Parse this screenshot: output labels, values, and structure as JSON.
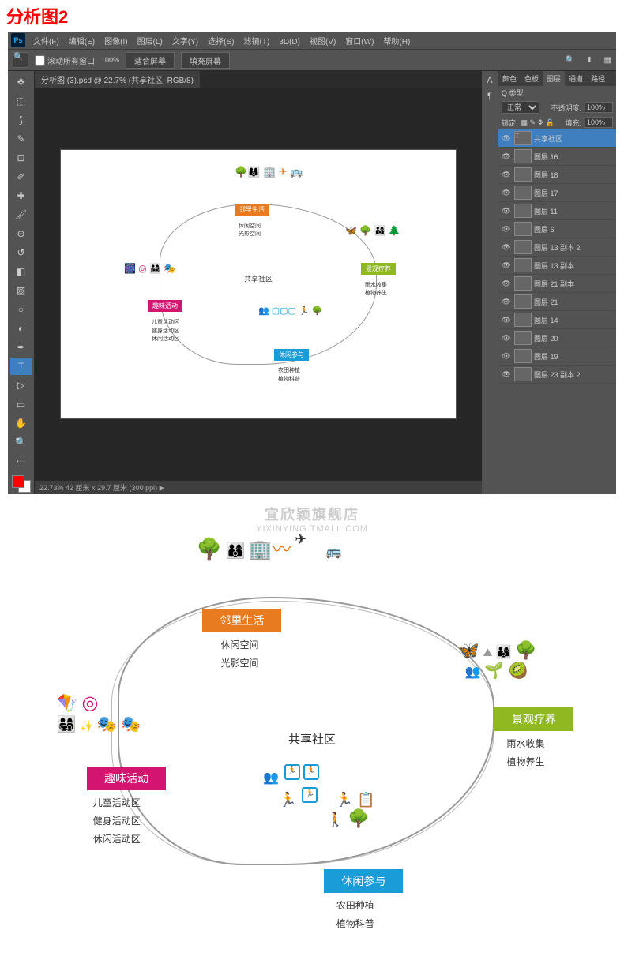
{
  "page_title": "分析图2",
  "photoshop": {
    "menu": [
      "文件(F)",
      "编辑(E)",
      "图像(I)",
      "图层(L)",
      "文字(Y)",
      "选择(S)",
      "滤镜(T)",
      "3D(D)",
      "视图(V)",
      "窗口(W)",
      "帮助(H)"
    ],
    "optionbar": {
      "checkbox_label": "滚动所有窗口",
      "btn1": "适合屏幕",
      "btn2": "填充屏幕"
    },
    "doc_tab": "分析图 (3).psd @ 22.7% (共享社区, RGB/8)",
    "status": "22.73%    42 厘米 x 29.7 厘米 (300 ppi)    ▶",
    "panel_tabs": [
      "颜色",
      "色板",
      "图层",
      "通道",
      "路径"
    ],
    "panel_tabs_active": 2,
    "panel_opts": {
      "type_label": "Q 类型",
      "blend": "正常",
      "opacity_label": "不透明度:",
      "opacity": "100%",
      "lock_label": "锁定:",
      "fill_label": "填充:",
      "fill": "100%"
    },
    "layers": [
      {
        "name": "共享社区",
        "active": true,
        "type": "T"
      },
      {
        "name": "图层 16"
      },
      {
        "name": "图层 18"
      },
      {
        "name": "图层 17"
      },
      {
        "name": "图层 11"
      },
      {
        "name": "图层 6"
      },
      {
        "name": "图层 13 副本 2"
      },
      {
        "name": "图层 13 副本"
      },
      {
        "name": "图层 21 副本"
      },
      {
        "name": "图层 21"
      },
      {
        "name": "图层 14"
      },
      {
        "name": "图层 20"
      },
      {
        "name": "图层 19"
      },
      {
        "name": "图层 23 副本 2"
      }
    ]
  },
  "diagram": {
    "center": "共享社区",
    "nodes": {
      "orange": {
        "title": "邻里生活",
        "subs": [
          "休闲空间",
          "光影空间"
        ],
        "color": "#e87a1f"
      },
      "green": {
        "title": "景观疗养",
        "subs": [
          "雨水收集",
          "植物养生"
        ],
        "color": "#8fb821"
      },
      "magenta": {
        "title": "趣味活动",
        "subs": [
          "儿童活动区",
          "健身活动区",
          "休闲活动区"
        ],
        "color": "#d4156f"
      },
      "blue": {
        "title": "休闲参与",
        "subs": [
          "农田种植",
          "植物科普"
        ],
        "color": "#1a9cd8"
      }
    }
  },
  "watermark": {
    "line1": "宜欣颖旗舰店",
    "line2": "YIXINYING.TMALL.COM"
  }
}
